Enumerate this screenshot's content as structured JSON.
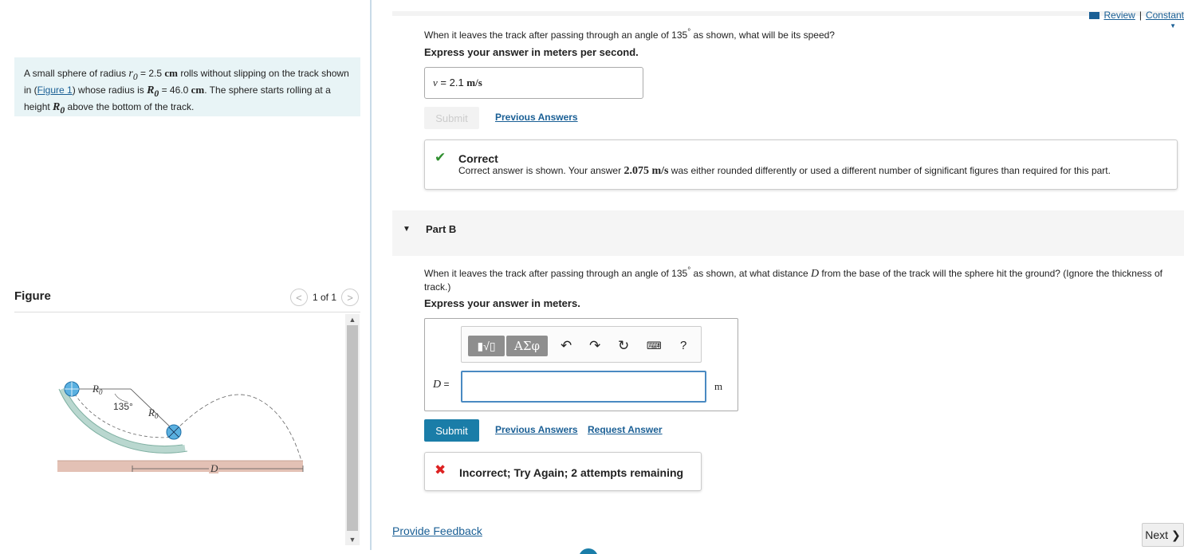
{
  "header": {
    "review_link": "Review",
    "separator": "|",
    "constants_link": "Constant"
  },
  "problem": {
    "t1": "A small sphere of radius ",
    "r0_sym": "r",
    "r0_sub": "0",
    "t2": " = 2.5 ",
    "r0_unit": "cm",
    "t3": " rolls without slipping on the track shown in (",
    "figure_link": "Figure 1",
    "t4": ") whose radius is ",
    "R0_sym": "R",
    "R0_sub": "0",
    "t5": " = 46.0 ",
    "R0_unit": "cm",
    "t6": ". The sphere starts rolling at a height ",
    "t7": " above the bottom of the track."
  },
  "figure_panel": {
    "title": "Figure",
    "page": "1 of 1",
    "prev": "<",
    "next": ">",
    "labels": {
      "r0_a": "R",
      "r0_a_sub": "0",
      "angle": "135°",
      "r0_b": "R",
      "r0_b_sub": "0",
      "d": "D"
    }
  },
  "part_a": {
    "question_1": "When it leaves the track after passing through an angle of 135",
    "deg": "°",
    "question_2": " as shown, what will be its speed?",
    "instruction": "Express your answer in meters per second.",
    "answer_var": "v",
    "answer_rest": " = 2.1 ",
    "answer_unit": "m/s",
    "submit_label": "Submit",
    "previous_answers": "Previous Answers",
    "feedback_title": "Correct",
    "feedback_t1": "Correct answer is shown. Your answer ",
    "feedback_val": "2.075 m/s",
    "feedback_t2": " was either rounded differently or used a different number of significant figures than required for this part."
  },
  "part_b": {
    "title": "Part B",
    "question_1": "When it leaves the track after passing through an angle of 135",
    "deg": "°",
    "question_2": " as shown, at what distance ",
    "d_sym": "D",
    "question_3": " from the base of the track will the sphere hit the ground? (Ignore the thickness of track.)",
    "instruction": "Express your answer in meters.",
    "toolbar_greek": "ΑΣφ",
    "toolbar_help": "?",
    "input_label_var": "D",
    "input_label_eq": " =",
    "input_value": "",
    "unit": "m",
    "submit_label": "Submit",
    "previous_answers": "Previous Answers",
    "request_answer": "Request Answer",
    "feedback_title": "Incorrect; Try Again; 2 attempts remaining"
  },
  "footer": {
    "provide_feedback": "Provide Feedback",
    "next_label": "Next"
  }
}
